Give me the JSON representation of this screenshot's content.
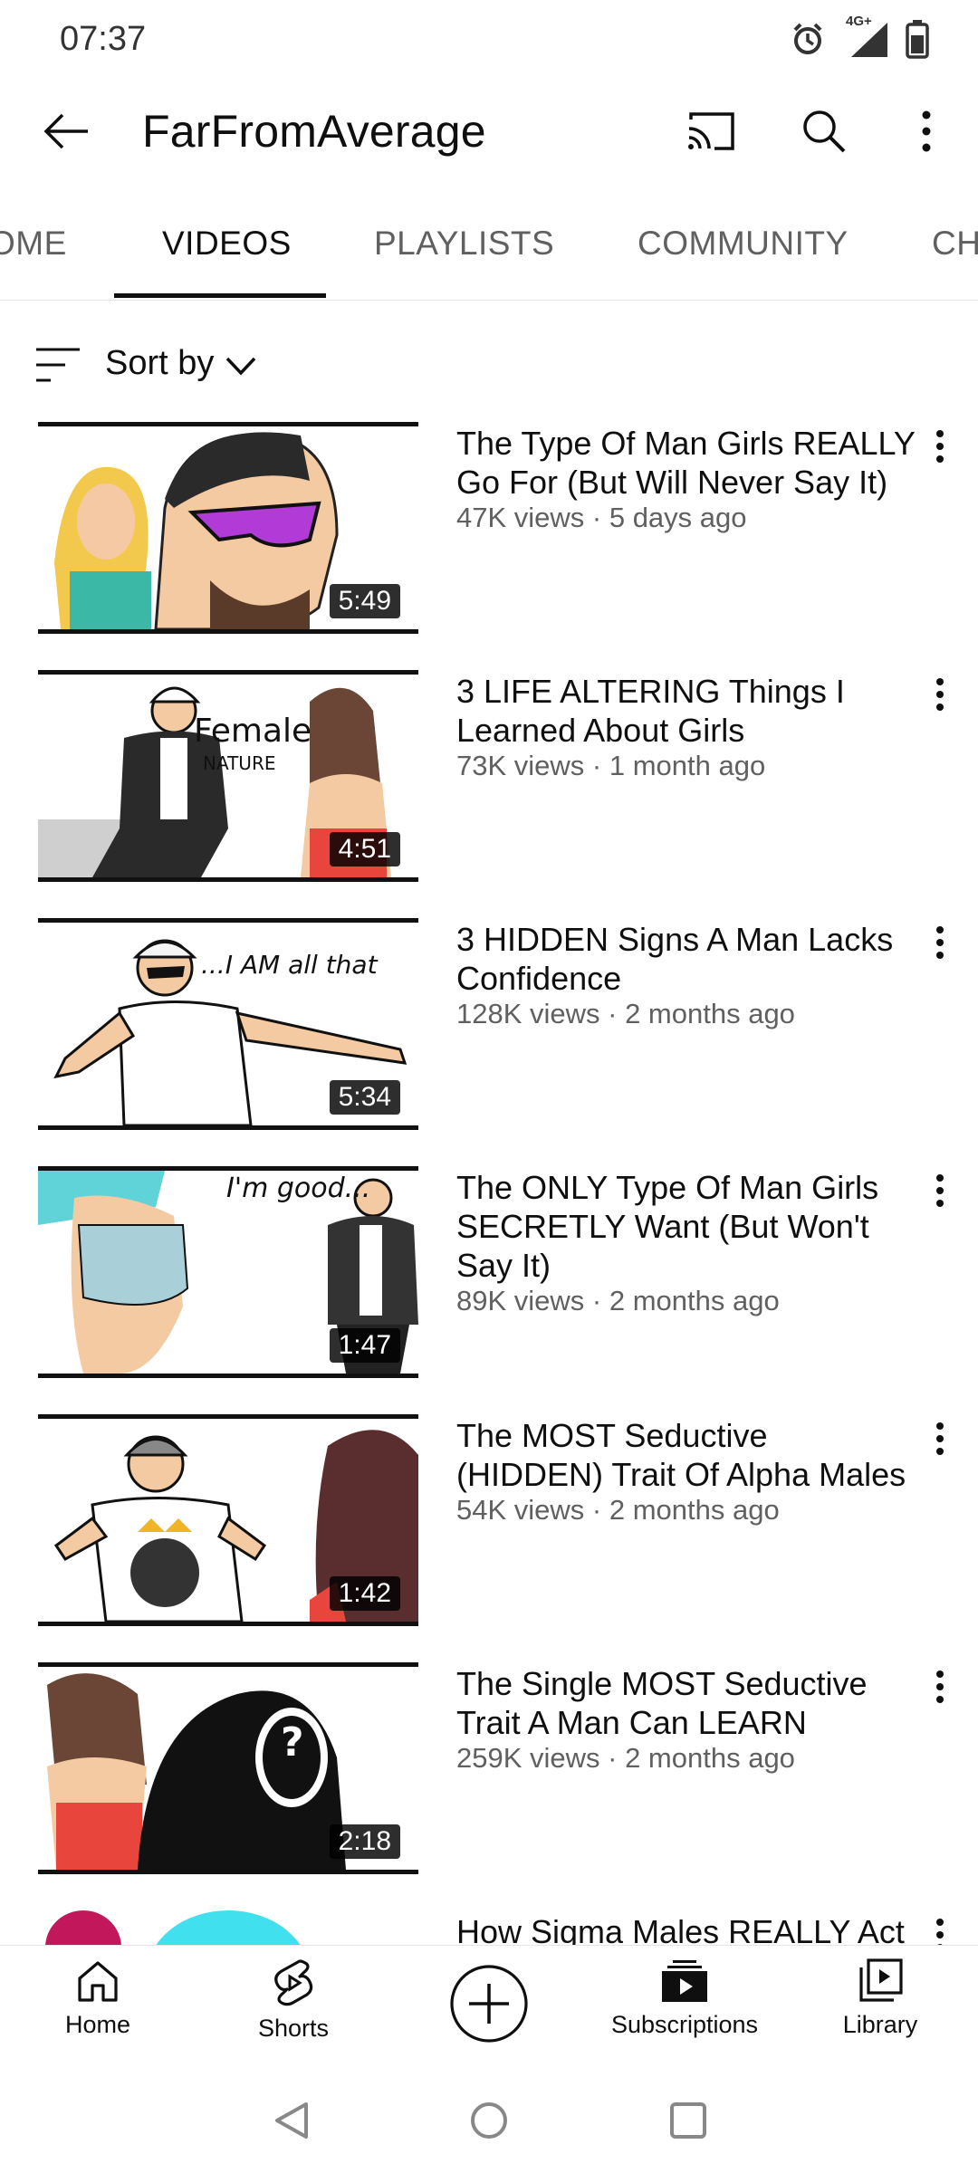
{
  "status_bar": {
    "time": "07:37",
    "network_label": "4G+",
    "icons": [
      "alarm-icon",
      "signal-icon",
      "battery-icon"
    ]
  },
  "app_bar": {
    "channel_name": "FarFromAverage",
    "icons": [
      "back-arrow-icon",
      "cast-icon",
      "search-icon",
      "more-vert-icon"
    ]
  },
  "tabs": [
    {
      "label": "HOME",
      "visible_text": "OME",
      "active": false
    },
    {
      "label": "VIDEOS",
      "visible_text": "VIDEOS",
      "active": true
    },
    {
      "label": "PLAYLISTS",
      "visible_text": "PLAYLISTS",
      "active": false
    },
    {
      "label": "COMMUNITY",
      "visible_text": "COMMUNITY",
      "active": false
    },
    {
      "label": "CHANNELS",
      "visible_text": "CH",
      "active": false
    }
  ],
  "sort": {
    "label": "Sort by"
  },
  "videos": [
    {
      "title": "The Type Of Man Girls REALLY Go For (But Will Never Say It)",
      "meta": "47K views · 5 days ago",
      "duration": "5:49",
      "thumbnail_text": ""
    },
    {
      "title": "3 LIFE ALTERING Things I Learned About Girls",
      "meta": "73K views · 1 month ago",
      "duration": "4:51",
      "thumbnail_text": "Female",
      "thumbnail_subtext": "NATURE"
    },
    {
      "title": "3 HIDDEN Signs A Man Lacks Confidence",
      "meta": "128K views · 2 months ago",
      "duration": "5:34",
      "thumbnail_text": "...I AM all that"
    },
    {
      "title": "The ONLY Type Of Man Girls SECRETLY Want (But Won't Say It)",
      "meta": "89K views · 2 months ago",
      "duration": "1:47",
      "thumbnail_text": "I'm good..."
    },
    {
      "title": "The MOST Seductive (HIDDEN) Trait Of Alpha Males",
      "meta": "54K views · 2 months ago",
      "duration": "1:42",
      "thumbnail_text": ""
    },
    {
      "title": "The Single MOST Seductive Trait A Man Can LEARN",
      "meta": "259K views · 2 months ago",
      "duration": "2:18",
      "thumbnail_text": "?"
    },
    {
      "title": "How Sigma Males REALLY Act",
      "meta": "",
      "duration": "",
      "thumbnail_text": ""
    }
  ],
  "bottom_nav": [
    {
      "label": "Home",
      "icon": "home-icon"
    },
    {
      "label": "Shorts",
      "icon": "shorts-icon"
    },
    {
      "label": "",
      "icon": "create-plus-icon"
    },
    {
      "label": "Subscriptions",
      "icon": "subscriptions-icon"
    },
    {
      "label": "Library",
      "icon": "library-icon"
    }
  ],
  "system_nav": [
    "back-triangle-icon",
    "home-circle-icon",
    "recents-square-icon"
  ],
  "colors": {
    "primary_text": "#0f0f0f",
    "secondary_text": "#606060",
    "background": "#ffffff"
  }
}
